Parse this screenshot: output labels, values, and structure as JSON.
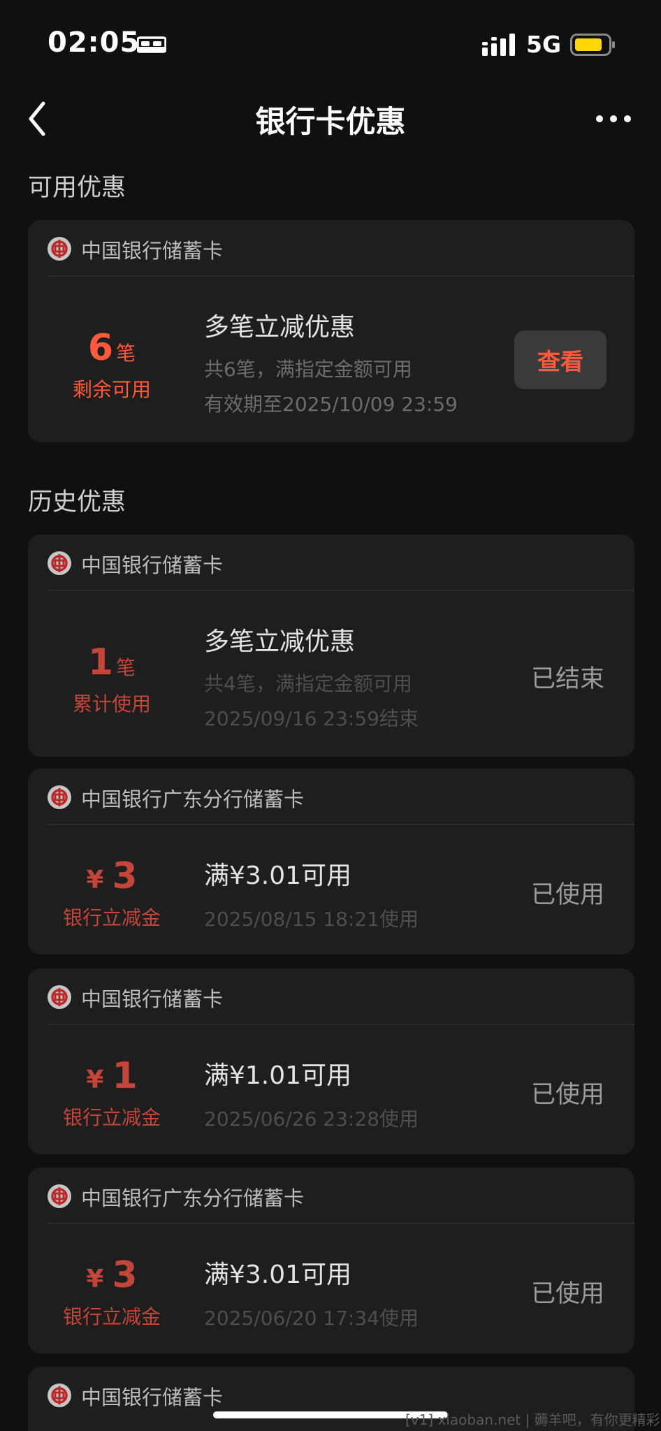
{
  "status_bar": {
    "time": "02:05",
    "network": "5G"
  },
  "header": {
    "title": "银行卡优惠"
  },
  "sections": {
    "available": "可用优惠",
    "history": "历史优惠"
  },
  "available_card": {
    "bank": "中国银行储蓄卡",
    "count": "6",
    "unit": "笔",
    "caption": "剩余可用",
    "title": "多笔立减优惠",
    "desc": "共6笔，满指定金额可用",
    "validity": "有效期至2025/10/09 23:59",
    "button_label": "查看"
  },
  "history_cards": [
    {
      "bank": "中国银行储蓄卡",
      "count": "1",
      "unit": "笔",
      "caption": "累计使用",
      "title": "多笔立减优惠",
      "desc": "共4笔，满指定金额可用",
      "date": "2025/09/16 23:59结束",
      "status": "已结束"
    },
    {
      "bank": "中国银行广东分行储蓄卡",
      "currency": "¥",
      "amount": "3",
      "caption": "银行立减金",
      "title": "满¥3.01可用",
      "date": "2025/08/15 18:21使用",
      "status": "已使用"
    },
    {
      "bank": "中国银行储蓄卡",
      "currency": "¥",
      "amount": "1",
      "caption": "银行立减金",
      "title": "满¥1.01可用",
      "date": "2025/06/26 23:28使用",
      "status": "已使用"
    },
    {
      "bank": "中国银行广东分行储蓄卡",
      "currency": "¥",
      "amount": "3",
      "caption": "银行立减金",
      "title": "满¥3.01可用",
      "date": "2025/06/20 17:34使用",
      "status": "已使用"
    },
    {
      "bank": "中国银行储蓄卡"
    }
  ],
  "footer": {
    "watermark": "[v1] xiaoban.net | 薅羊吧，有你更精彩！"
  },
  "colors": {
    "accent": "#ff5a3c",
    "used_red": "#c4453a",
    "background": "#101010",
    "card": "#1e1e1e"
  },
  "icons": {
    "status": [
      "bed-icon",
      "signal-icon",
      "battery-icon"
    ],
    "nav": [
      "back-icon",
      "more-icon"
    ],
    "card": "bank-of-china-logo-icon"
  }
}
